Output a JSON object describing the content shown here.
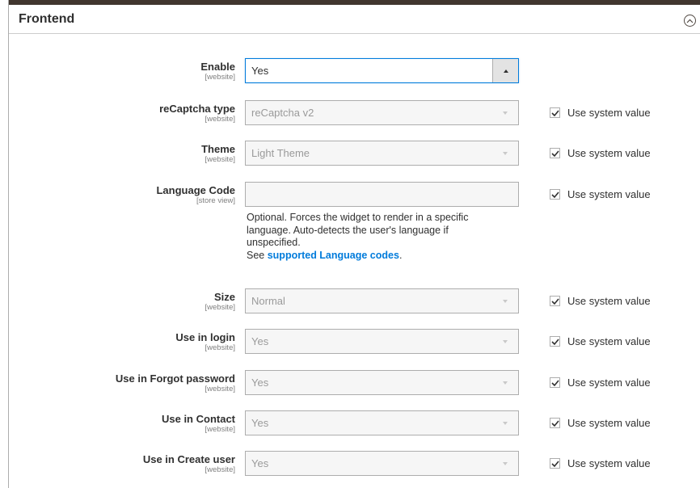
{
  "section": {
    "title": "Frontend"
  },
  "fields": [
    {
      "label": "Enable",
      "scope": "[website]",
      "value": "Yes",
      "active": true
    },
    {
      "label": "reCaptcha type",
      "scope": "[website]",
      "value": "reCaptcha v2",
      "use_system_value": "Use system value"
    },
    {
      "label": "Theme",
      "scope": "[website]",
      "value": "Light Theme",
      "use_system_value": "Use system value"
    },
    {
      "label": "Language Code",
      "scope": "[store view]",
      "value": "",
      "use_system_value": "Use system value"
    },
    {
      "label": "Size",
      "scope": "[website]",
      "value": "Normal",
      "use_system_value": "Use system value"
    },
    {
      "label": "Use in login",
      "scope": "[website]",
      "value": "Yes",
      "use_system_value": "Use system value"
    },
    {
      "label": "Use in Forgot password",
      "scope": "[website]",
      "value": "Yes",
      "use_system_value": "Use system value"
    },
    {
      "label": "Use in Contact",
      "scope": "[website]",
      "value": "Yes",
      "use_system_value": "Use system value"
    },
    {
      "label": "Use in Create user",
      "scope": "[website]",
      "value": "Yes",
      "use_system_value": "Use system value"
    }
  ],
  "language_note": {
    "line1": "Optional. Forces the widget to render in a specific language. Auto-detects the user's language if unspecified.",
    "see": "See ",
    "link": "supported Language codes",
    "end": "."
  },
  "colors": {
    "accent": "#007bdb",
    "border": "#adadad",
    "disabled_bg": "#f6f6f6"
  },
  "icons": {
    "collapse": "chevron-up-circle-icon",
    "check": "checkmark-icon",
    "dropdown": "triangle-down-icon"
  }
}
